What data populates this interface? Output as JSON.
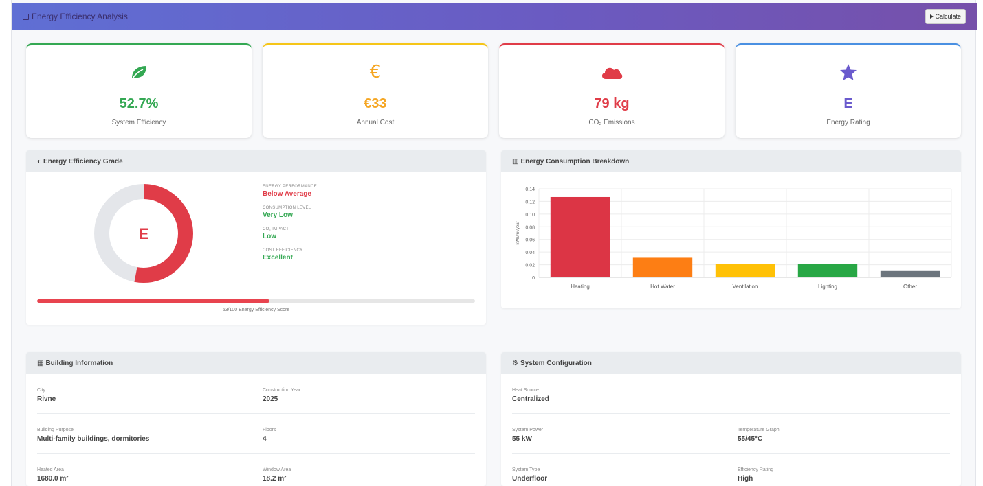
{
  "header": {
    "title": "Energy Efficiency Analysis",
    "calculate_label": "Calculate"
  },
  "colors": {
    "green": "#34a853",
    "orange": "#f5a623",
    "red": "#e03c48",
    "purple": "#6a5acd",
    "blue": "#4a90e2"
  },
  "kpis": [
    {
      "value": "52.7%",
      "label": "System Efficiency",
      "icon": "leaf-icon"
    },
    {
      "value": "€33",
      "label": "Annual Cost",
      "icon": "euro-icon"
    },
    {
      "value": "79 kg",
      "label": "CO₂ Emissions",
      "icon": "cloud-icon"
    },
    {
      "value": "E",
      "label": "Energy Rating",
      "icon": "star-icon"
    }
  ],
  "grade": {
    "title": "Energy Efficiency Grade",
    "letter": "E",
    "score": 53,
    "score_text": "53/100 Energy Efficiency Score",
    "items": [
      {
        "label": "Energy Performance",
        "value": "Below Average"
      },
      {
        "label": "Consumption Level",
        "value": "Very Low"
      },
      {
        "label": "CO₂ Impact",
        "value": "Low"
      },
      {
        "label": "Cost Efficiency",
        "value": "Excellent"
      }
    ]
  },
  "breakdown": {
    "title": "Energy Consumption Breakdown"
  },
  "chart_data": {
    "type": "bar",
    "categories": [
      "Heating",
      "Hot Water",
      "Ventilation",
      "Lighting",
      "Other"
    ],
    "values": [
      0.127,
      0.031,
      0.021,
      0.021,
      0.01
    ],
    "ylim": [
      0,
      0.14
    ],
    "yticks": [
      "0.14",
      "0.12",
      "0.10",
      "0.08",
      "0.06",
      "0.04",
      "0.02",
      "0"
    ],
    "ylabel": "kWh/m²/year",
    "colors": [
      "#dc3545",
      "#fd7e14",
      "#ffc107",
      "#28a745",
      "#6c757d"
    ],
    "grid": true
  },
  "building": {
    "title": "Building Information",
    "fields": [
      {
        "label": "City",
        "value": "Rivne"
      },
      {
        "label": "Construction Year",
        "value": "2025"
      },
      {
        "label": "Building Purpose",
        "value": "Multi-family buildings, dormitories"
      },
      {
        "label": "Floors",
        "value": "4"
      },
      {
        "label": "Heated Area",
        "value": "1680.0 m²"
      },
      {
        "label": "Window Area",
        "value": "18.2 m²"
      }
    ]
  },
  "system": {
    "title": "System Configuration",
    "fields": [
      {
        "label": "Heat Source",
        "value": "Centralized"
      },
      {
        "label": "System Power",
        "value": "55 kW"
      },
      {
        "label": "Temperature Graph",
        "value": "55/45°C"
      },
      {
        "label": "System Type",
        "value": "Underfloor"
      },
      {
        "label": "Efficiency Rating",
        "value": "High"
      }
    ]
  }
}
